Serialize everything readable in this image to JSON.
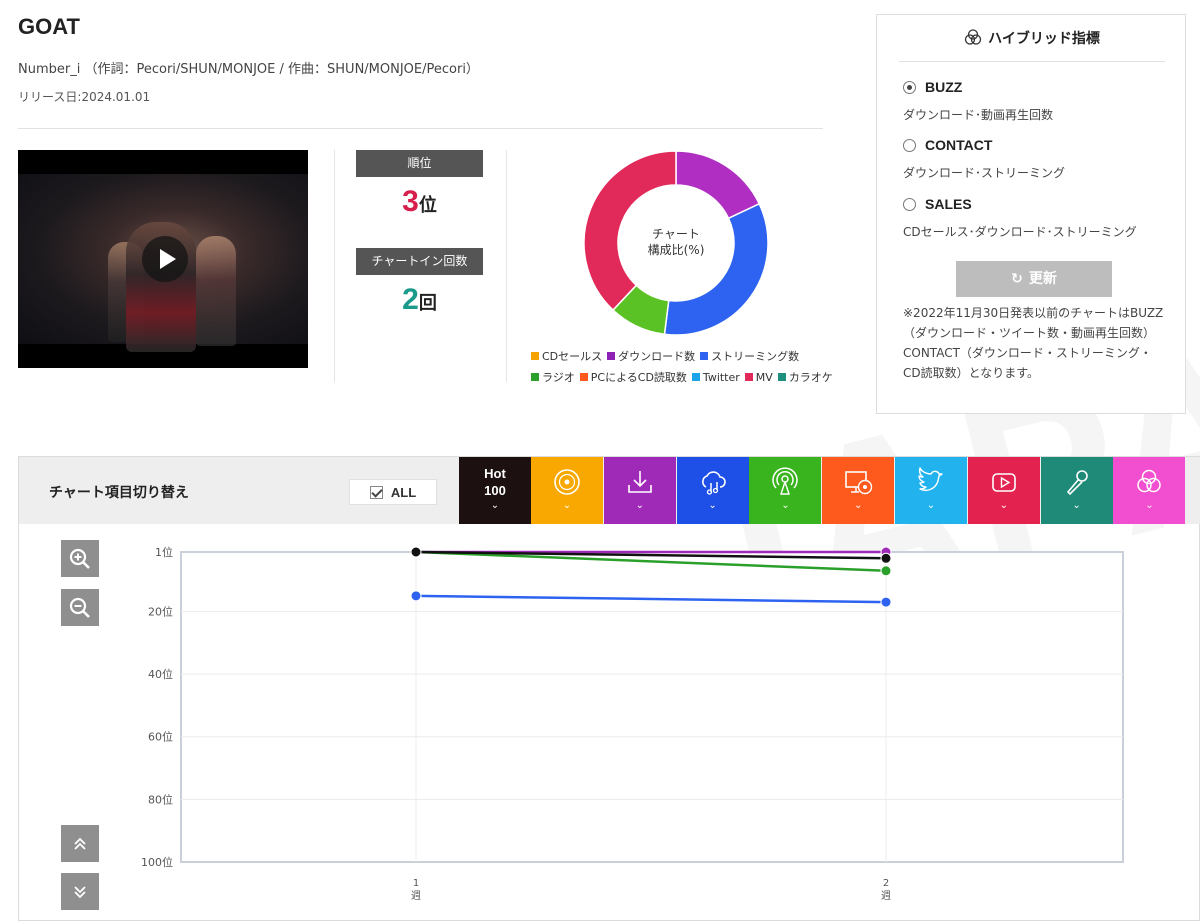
{
  "song": {
    "title": "GOAT",
    "credits": "Number_i （作詞：Pecori/SHUN/MONJOE / 作曲：SHUN/MONJOE/Pecori）",
    "release": "リリース日:2024.01.01"
  },
  "rank": {
    "label": "順位",
    "value": "3",
    "unit": "位"
  },
  "chartin": {
    "label": "チャートイン回数",
    "value": "2",
    "unit": "回"
  },
  "donut": {
    "center_line1": "チャート",
    "center_line2": "構成比(%)",
    "segments": [
      {
        "name": "ダウンロード数",
        "color": "#b02fc2",
        "value": 18
      },
      {
        "name": "ストリーミング数",
        "color": "#2d63f0",
        "value": 34
      },
      {
        "name": "ラジオ",
        "color": "#5ac224",
        "value": 10
      },
      {
        "name": "MV",
        "color": "#e22a5a",
        "value": 38
      }
    ],
    "legend_row1": [
      {
        "name": "CDセールス",
        "color": "#f5a300"
      },
      {
        "name": "ダウンロード数",
        "color": "#8e22b5"
      },
      {
        "name": "ストリーミング数",
        "color": "#2d63f0"
      }
    ],
    "legend_row2": [
      {
        "name": "ラジオ",
        "color": "#2aa02a"
      },
      {
        "name": "PCによるCD読取数",
        "color": "#ff5a1e"
      },
      {
        "name": "Twitter",
        "color": "#1ba4e8"
      },
      {
        "name": "MV",
        "color": "#e22a5a"
      },
      {
        "name": "カラオケ",
        "color": "#1f8f80"
      }
    ]
  },
  "hybrid": {
    "title": "ハイブリッド指標",
    "options": [
      {
        "name": "BUZZ",
        "desc": "ダウンロード･動画再生回数",
        "selected": true
      },
      {
        "name": "CONTACT",
        "desc": "ダウンロード･ストリーミング",
        "selected": false
      },
      {
        "name": "SALES",
        "desc": "CDセールス･ダウンロード･ストリーミング",
        "selected": false
      }
    ],
    "update_label": "更新",
    "note": "※2022年11月30日発表以前のチャートはBUZZ（ダウンロード・ツイート数・動画再生回数）CONTACT（ダウンロード・ストリーミング・CD読取数）となります。"
  },
  "chart_switch": {
    "title": "チャート項目切り替え",
    "all_label": "ALL",
    "hot_label_line1": "Hot",
    "hot_label_line2": "100",
    "tabs": [
      {
        "icon": "cd-icon",
        "color": "#f8a800"
      },
      {
        "icon": "download-icon",
        "color": "#a02ab8"
      },
      {
        "icon": "streaming-cloud-icon",
        "color": "#1e4fe6"
      },
      {
        "icon": "radio-icon",
        "color": "#39b41e"
      },
      {
        "icon": "pc-cd-icon",
        "color": "#ff5a1e"
      },
      {
        "icon": "twitter-icon",
        "color": "#22b2ee"
      },
      {
        "icon": "youtube-icon",
        "color": "#e3224f"
      },
      {
        "icon": "karaoke-mic-icon",
        "color": "#1f8a78"
      },
      {
        "icon": "hybrid-icon",
        "color": "#f24fd0"
      }
    ],
    "hot_color": "#1c1010"
  },
  "chart_data": {
    "type": "line",
    "x": [
      "1週",
      "2週"
    ],
    "y_ticks": [
      "1位",
      "20位",
      "40位",
      "60位",
      "80位",
      "100位"
    ],
    "y_tick_values": [
      1,
      20,
      40,
      60,
      80,
      100
    ],
    "ylim": [
      1,
      100
    ],
    "y_inverted": true,
    "grid": true,
    "series": [
      {
        "color": "#a02ab8",
        "values": [
          1,
          1
        ]
      },
      {
        "color": "#2aa02a",
        "values": [
          1,
          7
        ]
      },
      {
        "color": "#2d63f0",
        "values": [
          15,
          17
        ]
      },
      {
        "color": "#111111",
        "values": [
          1,
          3
        ]
      }
    ]
  }
}
